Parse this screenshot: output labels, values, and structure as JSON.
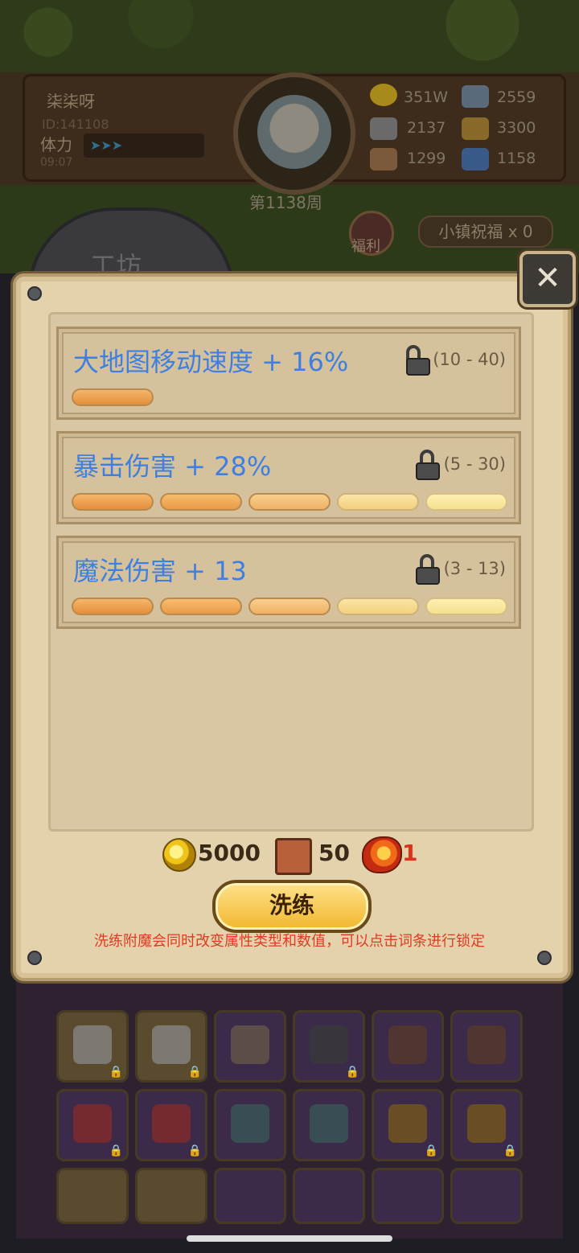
{
  "player": {
    "name": "柒柒呀",
    "id": "ID:141108",
    "stamina_label": "体力",
    "stamina_time": "09:07",
    "week": "第1138周"
  },
  "resources": [
    {
      "name": "gold-icon",
      "value": "351W",
      "color": "#c9a81a"
    },
    {
      "name": "iron-icon",
      "value": "2559",
      "color": "#7a8a9a"
    },
    {
      "name": "stone-icon",
      "value": "2137",
      "color": "#8a8a8a"
    },
    {
      "name": "cloth-icon",
      "value": "3300",
      "color": "#b08a3a"
    },
    {
      "name": "wood-icon",
      "value": "1299",
      "color": "#a07a4a"
    },
    {
      "name": "crystal-icon",
      "value": "1158",
      "color": "#4a7ab0"
    }
  ],
  "welfare_label": "福利",
  "blessing_label": "小镇祝福 x 0",
  "workshop_label": "工坊",
  "attributes": [
    {
      "name": "大地图移动速度 + 16%",
      "range": "(10 - 40)",
      "locked": false,
      "segments": 1
    },
    {
      "name": "暴击伤害 + 28%",
      "range": "(5 - 30)",
      "locked": true,
      "segments": 5
    },
    {
      "name": "魔法伤害 + 13",
      "range": "(3 - 13)",
      "locked": true,
      "segments": 5
    }
  ],
  "cost": {
    "gold": "5000",
    "scroll": "50",
    "gem": "1"
  },
  "refine_button": "洗练",
  "hint": "洗练附魔会同时改变属性类型和数值，可以点击词条进行锁定",
  "colors": {
    "attr_text": "#3f7fe0",
    "hint_text": "#e03b22",
    "modal_bg": "#e4d2ad"
  }
}
